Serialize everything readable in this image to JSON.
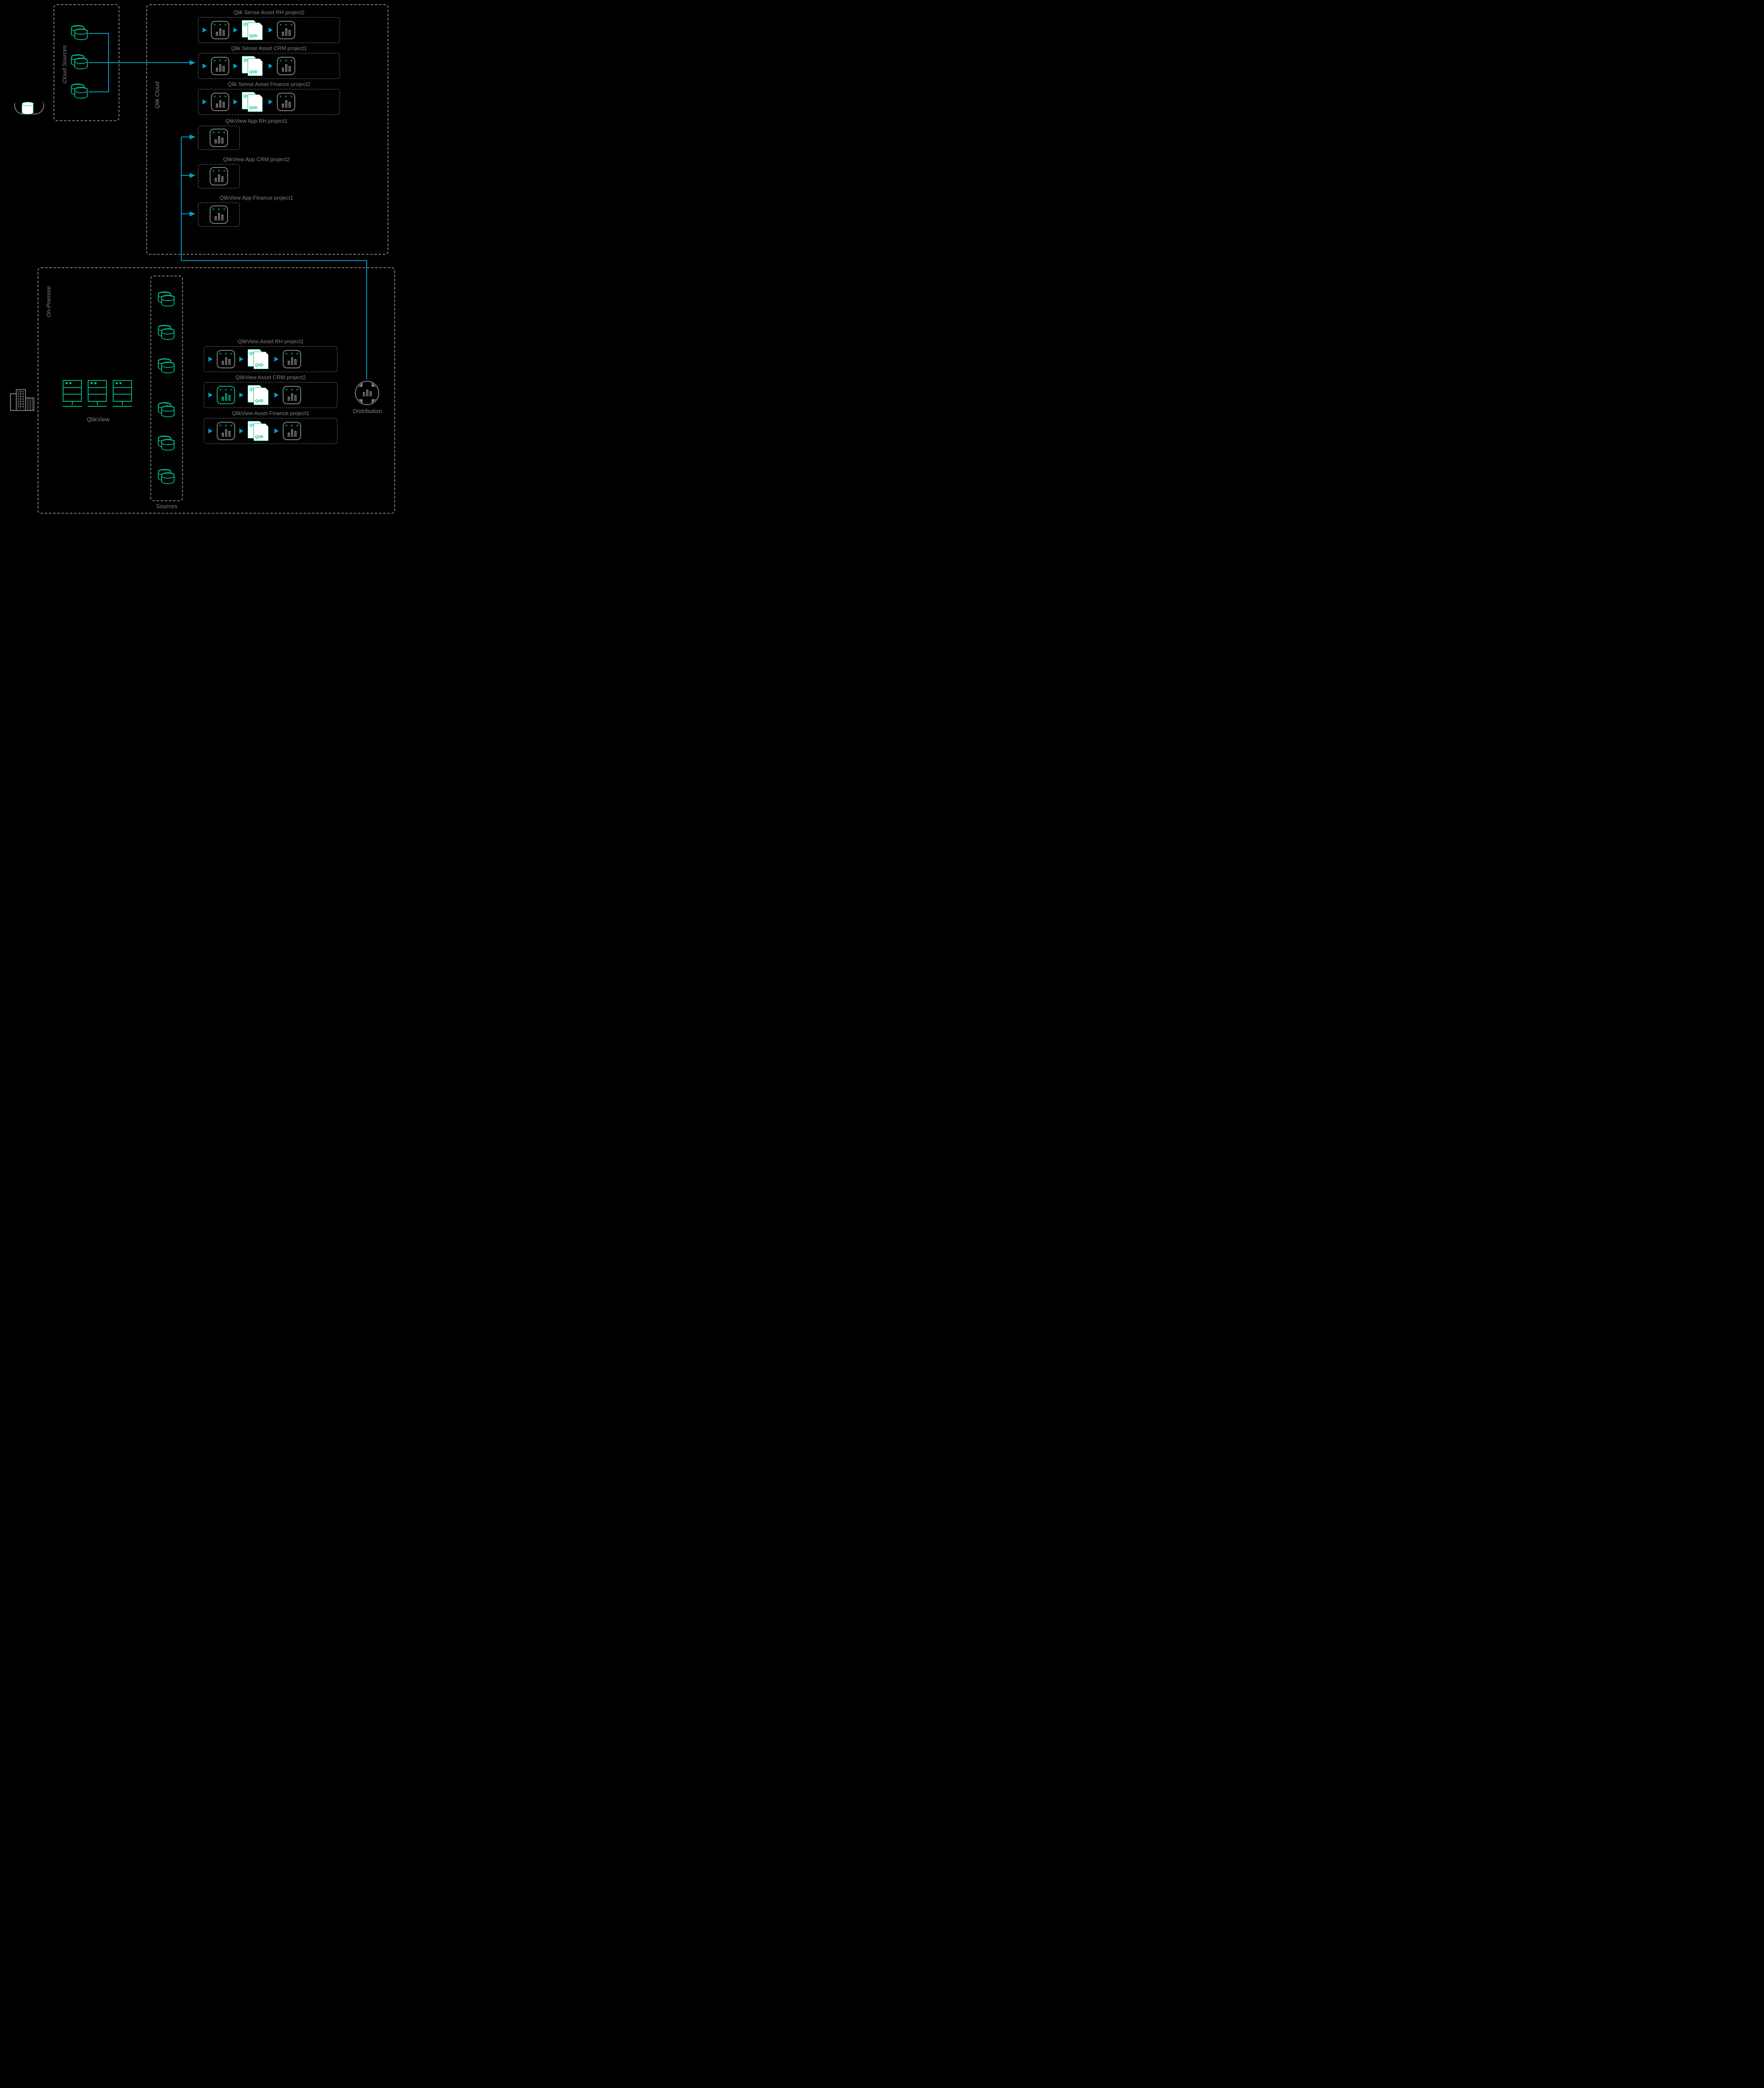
{
  "zones": {
    "cloud_sources": "Cloud Sources",
    "qlik_cloud": "Qlik Cloud",
    "on_premise": "On-Premise"
  },
  "labels": {
    "qlikview": "QlikView",
    "sources": "Sources",
    "distribution": "Distribution"
  },
  "qvd": {
    "back": "QV",
    "front": "QVD"
  },
  "qlik_cloud_assets": [
    {
      "title": "Qlik Sense Asset RH project2",
      "type": "full"
    },
    {
      "title": "Qlik Sense Asset CRM project1",
      "type": "full"
    },
    {
      "title": "Qlik Sense Asset Finance project2",
      "type": "full"
    },
    {
      "title": "QlikView App RH project1",
      "type": "app"
    },
    {
      "title": "QlikView App CRM project2",
      "type": "app"
    },
    {
      "title": "QlikView App Finance project1",
      "type": "app"
    }
  ],
  "on_prem_assets": [
    {
      "title": "QlikView Asset RH project1"
    },
    {
      "title": "QlikView Asset CRM project2"
    },
    {
      "title": "QlikView Asset Finance project1"
    }
  ]
}
